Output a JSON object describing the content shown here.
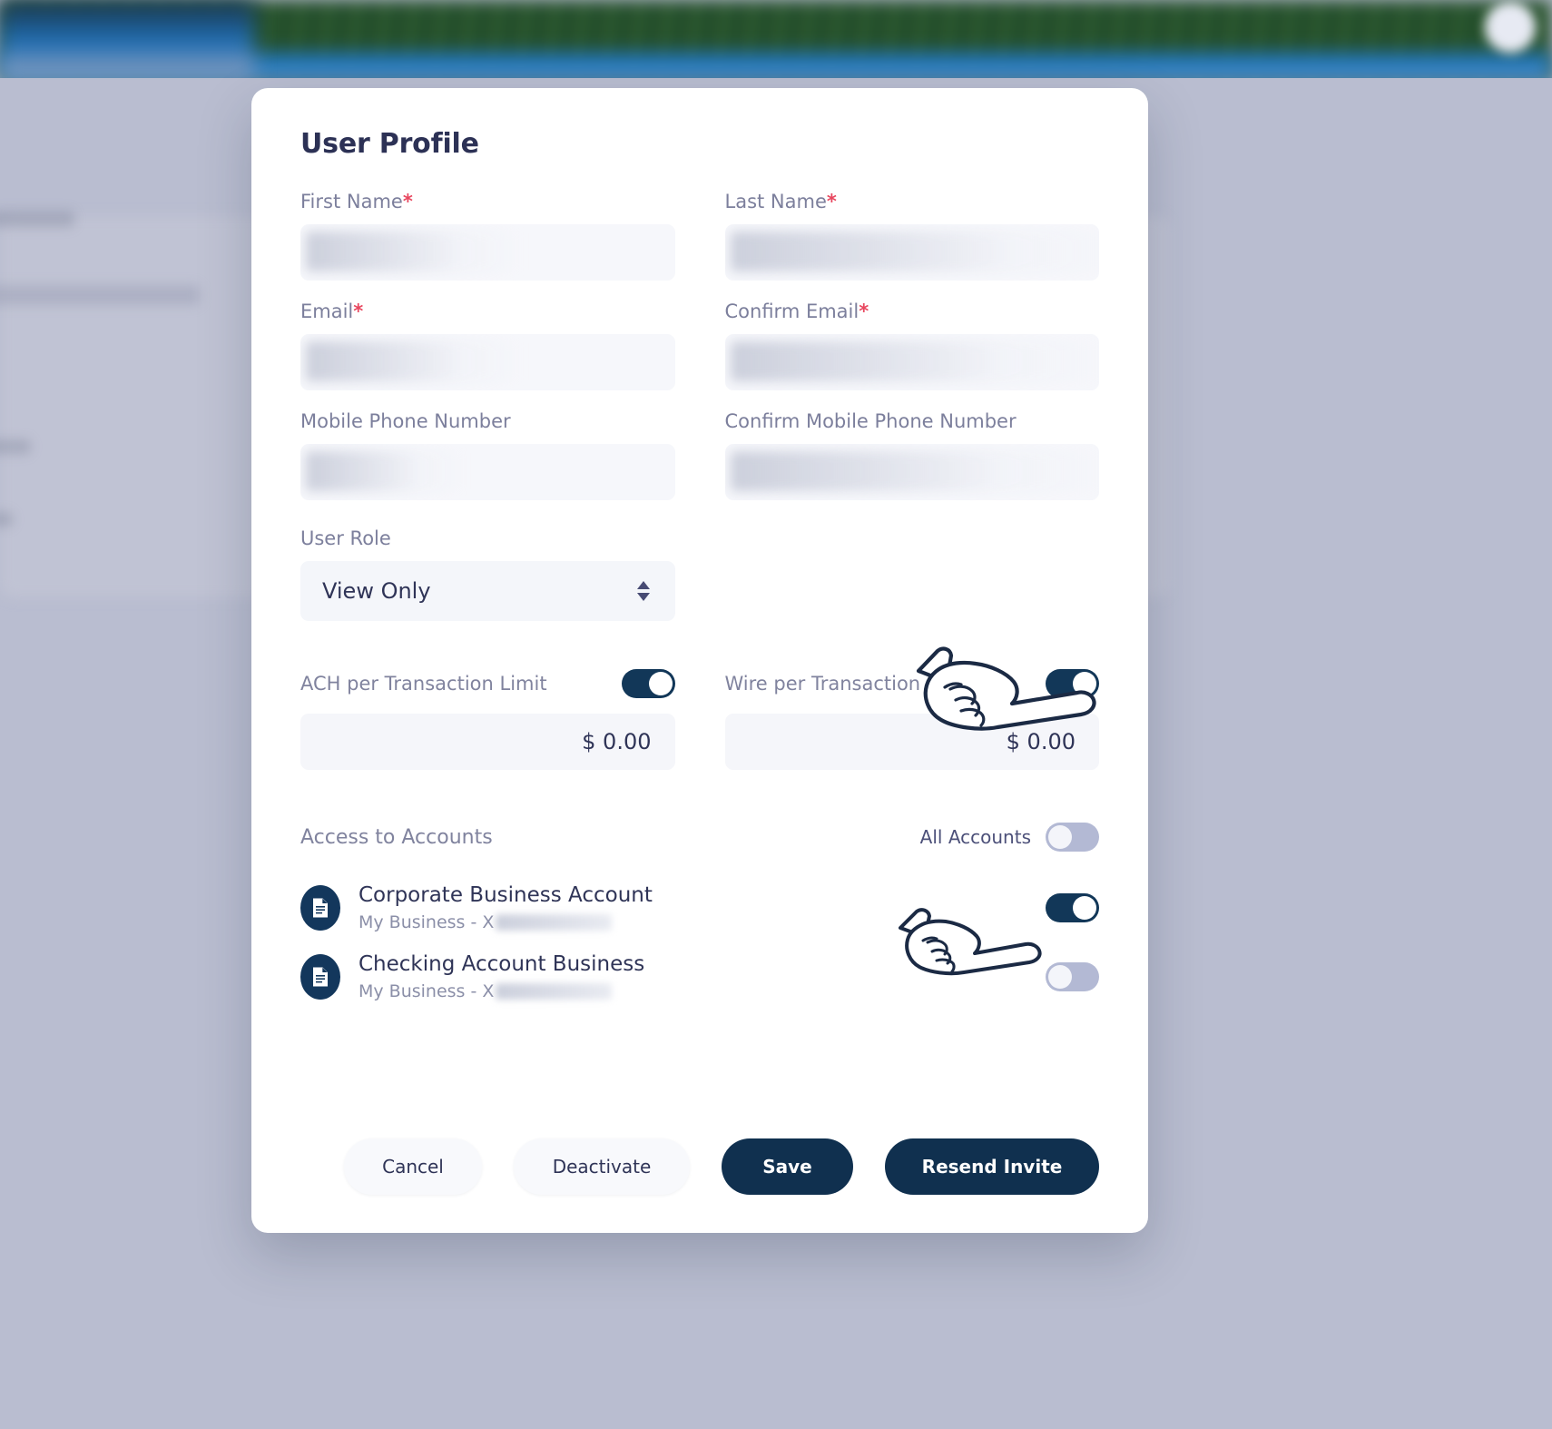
{
  "modal": {
    "title": "User Profile",
    "fields": [
      {
        "label": "First Name",
        "required": true,
        "value": "",
        "redacted": true
      },
      {
        "label": "Last Name",
        "required": true,
        "value": "",
        "redacted": true
      },
      {
        "label": "Email",
        "required": true,
        "value": "",
        "redacted": true
      },
      {
        "label": "Confirm Email",
        "required": true,
        "value": "",
        "redacted": true
      },
      {
        "label": "Mobile Phone Number",
        "required": false,
        "value": "",
        "redacted": true
      },
      {
        "label": "Confirm Mobile Phone Number",
        "required": false,
        "value": "",
        "redacted": true
      }
    ],
    "role": {
      "label": "User Role",
      "selected": "View Only"
    },
    "limits": [
      {
        "label": "ACH per Transaction Limit",
        "enabled": true,
        "amount": "$ 0.00"
      },
      {
        "label": "Wire per Transaction Limit",
        "enabled": true,
        "amount": "$ 0.00"
      }
    ],
    "access": {
      "title": "Access to Accounts",
      "all_accounts_label": "All Accounts",
      "all_accounts_enabled": false,
      "accounts": [
        {
          "name": "Corporate Business Account",
          "subtitle_prefix": "My Business - ",
          "subtitle_masked": "X",
          "enabled": true
        },
        {
          "name": "Checking Account Business",
          "subtitle_prefix": "My Business - ",
          "subtitle_masked": "X",
          "enabled": false
        }
      ]
    },
    "buttons": {
      "cancel": "Cancel",
      "deactivate": "Deactivate",
      "save": "Save",
      "resend": "Resend Invite"
    }
  },
  "colors": {
    "accent_dark": "#123758",
    "title": "#2c3155",
    "label": "#7c7f9c",
    "required_asterisk": "#e8475f",
    "toggle_off": "#b3b9d4",
    "page_backdrop": "#b9bdd0"
  },
  "icons": {
    "document": "document-icon",
    "stepper": "stepper-arrows-icon",
    "pointer": "pointing-hand-cursor"
  }
}
